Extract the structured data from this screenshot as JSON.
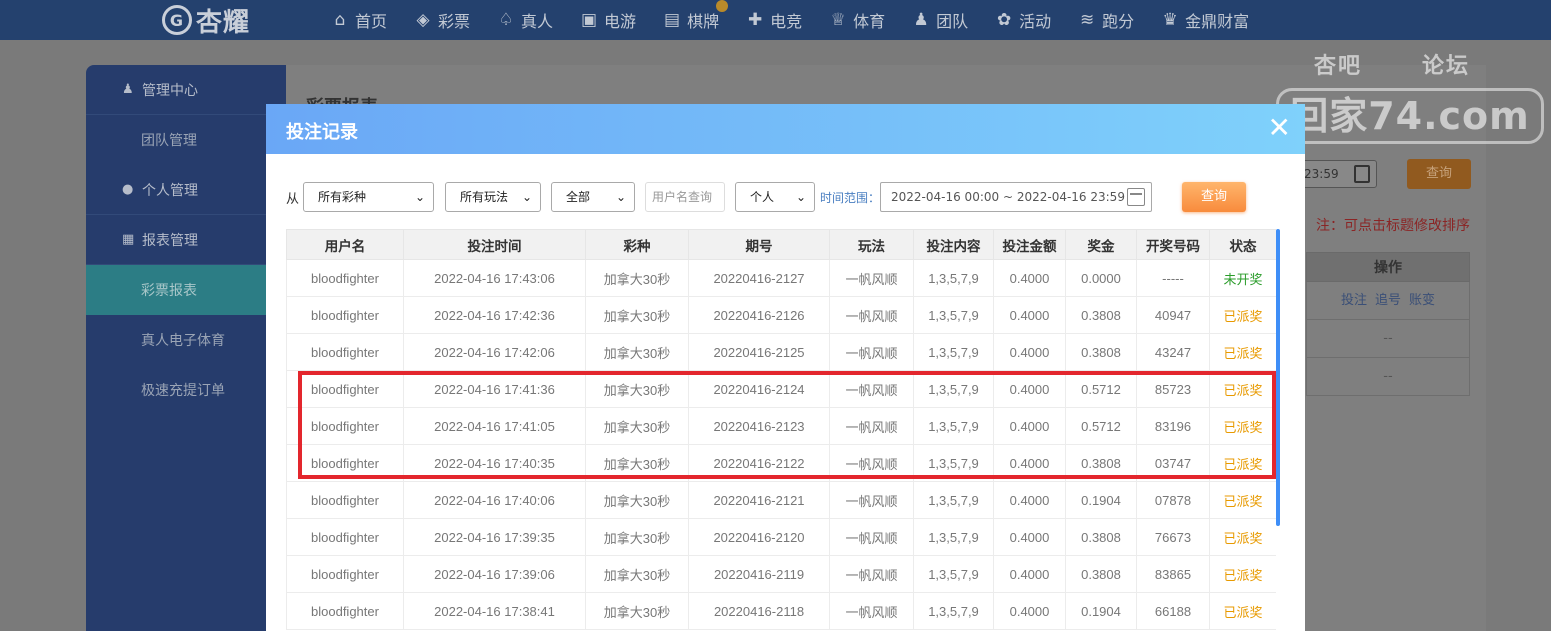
{
  "brand": {
    "logo_text": "杏耀"
  },
  "nav": [
    {
      "label": "首页",
      "icon": "home-icon",
      "glyph": "⌂"
    },
    {
      "label": "彩票",
      "icon": "lottery-icon",
      "glyph": "◈"
    },
    {
      "label": "真人",
      "icon": "live-casino-icon",
      "glyph": "♤"
    },
    {
      "label": "电游",
      "icon": "slot-icon",
      "glyph": "▣"
    },
    {
      "label": "棋牌",
      "icon": "cards-icon",
      "glyph": "▤"
    },
    {
      "label": "电竞",
      "icon": "gamepad-icon",
      "glyph": "✚"
    },
    {
      "label": "体育",
      "icon": "trophy-icon",
      "glyph": "♕"
    },
    {
      "label": "团队",
      "icon": "team-icon",
      "glyph": "♟"
    },
    {
      "label": "活动",
      "icon": "gift-icon",
      "glyph": "✿"
    },
    {
      "label": "跑分",
      "icon": "running-icon",
      "glyph": "≋"
    },
    {
      "label": "金鼎财富",
      "icon": "wealth-icon",
      "glyph": "♛"
    }
  ],
  "watermark": {
    "top_left": "杏吧",
    "top_right": "论坛",
    "domain": "回家74.com"
  },
  "sidebar": {
    "groups": [
      {
        "label": "管理中心",
        "icon": "admin-icon",
        "glyph": "♟",
        "items": [
          "团队管理"
        ]
      },
      {
        "label": "个人管理",
        "icon": "user-icon",
        "glyph": "●",
        "items": []
      },
      {
        "label": "报表管理",
        "icon": "report-icon",
        "glyph": "▦",
        "items": [
          "彩票报表",
          "真人电子体育",
          "极速充提订单"
        ]
      }
    ],
    "active_item": "彩票报表"
  },
  "background": {
    "title": "彩票报表",
    "date_fragment": "23:59",
    "query_label": "查询",
    "note": "注：可点击标题修改排序",
    "table_header": "操作",
    "action_links": [
      "投注",
      "追号",
      "账变"
    ],
    "empty_cells": [
      "--",
      "--"
    ]
  },
  "modal": {
    "title": "投注记录",
    "close_glyph": "✕",
    "filters": {
      "from_label": "从",
      "lottery_select": "所有彩种",
      "play_select": "所有玩法",
      "status_select": "全部",
      "username_placeholder": "用户名查询",
      "scope_select": "个人",
      "range_label": "时间范围：",
      "range_value": "2022-04-16 00:00 ~ 2022-04-16 23:59",
      "query_label": "查询"
    },
    "columns": [
      "用户名",
      "投注时间",
      "彩种",
      "期号",
      "玩法",
      "投注内容",
      "投注金额",
      "奖金",
      "开奖号码",
      "状态"
    ],
    "rows": [
      [
        "bloodfighter",
        "2022-04-16 17:43:06",
        "加拿大30秒",
        "20220416-2127",
        "一帆风顺",
        "1,3,5,7,9",
        "0.4000",
        "0.0000",
        "-----",
        "未开奖"
      ],
      [
        "bloodfighter",
        "2022-04-16 17:42:36",
        "加拿大30秒",
        "20220416-2126",
        "一帆风顺",
        "1,3,5,7,9",
        "0.4000",
        "0.3808",
        "40947",
        "已派奖"
      ],
      [
        "bloodfighter",
        "2022-04-16 17:42:06",
        "加拿大30秒",
        "20220416-2125",
        "一帆风顺",
        "1,3,5,7,9",
        "0.4000",
        "0.3808",
        "43247",
        "已派奖"
      ],
      [
        "bloodfighter",
        "2022-04-16 17:41:36",
        "加拿大30秒",
        "20220416-2124",
        "一帆风顺",
        "1,3,5,7,9",
        "0.4000",
        "0.5712",
        "85723",
        "已派奖"
      ],
      [
        "bloodfighter",
        "2022-04-16 17:41:05",
        "加拿大30秒",
        "20220416-2123",
        "一帆风顺",
        "1,3,5,7,9",
        "0.4000",
        "0.5712",
        "83196",
        "已派奖"
      ],
      [
        "bloodfighter",
        "2022-04-16 17:40:35",
        "加拿大30秒",
        "20220416-2122",
        "一帆风顺",
        "1,3,5,7,9",
        "0.4000",
        "0.3808",
        "03747",
        "已派奖"
      ],
      [
        "bloodfighter",
        "2022-04-16 17:40:06",
        "加拿大30秒",
        "20220416-2121",
        "一帆风顺",
        "1,3,5,7,9",
        "0.4000",
        "0.1904",
        "07878",
        "已派奖"
      ],
      [
        "bloodfighter",
        "2022-04-16 17:39:35",
        "加拿大30秒",
        "20220416-2120",
        "一帆风顺",
        "1,3,5,7,9",
        "0.4000",
        "0.3808",
        "76673",
        "已派奖"
      ],
      [
        "bloodfighter",
        "2022-04-16 17:39:06",
        "加拿大30秒",
        "20220416-2119",
        "一帆风顺",
        "1,3,5,7,9",
        "0.4000",
        "0.3808",
        "83865",
        "已派奖"
      ],
      [
        "bloodfighter",
        "2022-04-16 17:38:41",
        "加拿大30秒",
        "20220416-2118",
        "一帆风顺",
        "1,3,5,7,9",
        "0.4000",
        "0.1904",
        "66188",
        "已派奖"
      ]
    ],
    "highlighted_rows": [
      3,
      4,
      5
    ]
  },
  "colors": {
    "nav_bg": "#24416e",
    "sidebar_bg": "#263c6c",
    "active_item_bg": "#2c7d85",
    "modal_header_from": "#6aa7f6",
    "modal_header_to": "#7fd1fb",
    "query_button": "#f88b3c",
    "status_paid": "#e89a00",
    "status_pending": "#2a9c2a",
    "highlight_border": "#e3262d"
  }
}
